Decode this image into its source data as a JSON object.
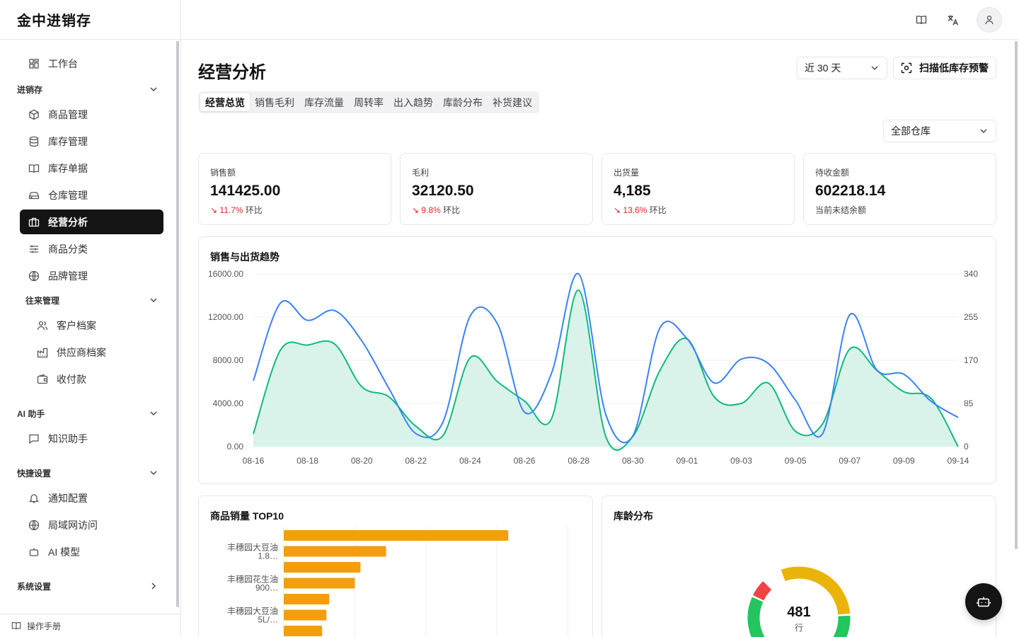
{
  "app": {
    "title": "金中进销存"
  },
  "sidebar": {
    "workspace": "工作台",
    "groups": {
      "inventory": "进销存",
      "partners": "往来管理",
      "ai": "AI 助手",
      "shortcuts": "快捷设置",
      "system": "系统设置"
    },
    "items": {
      "products": "商品管理",
      "stock": "库存管理",
      "documents": "库存单据",
      "warehouse": "仓库管理",
      "analytics": "经营分析",
      "categories": "商品分类",
      "brands": "品牌管理",
      "customers": "客户档案",
      "suppliers": "供应商档案",
      "payments": "收付款",
      "knowledge": "知识助手",
      "notifications": "通知配置",
      "lan": "局域网访问",
      "ai_model": "AI 模型"
    },
    "manual": "操作手册"
  },
  "page": {
    "title": "经营分析",
    "range": "近 30 天",
    "scan_button": "扫描低库存预警",
    "tabs": [
      "经营总览",
      "销售毛利",
      "库存流量",
      "周转率",
      "出入趋势",
      "库龄分布",
      "补货建议"
    ],
    "active_tab": 0,
    "warehouse": "全部仓库"
  },
  "kpis": [
    {
      "label": "销售额",
      "value": "141425.00",
      "change": "11.7%",
      "suffix": "环比"
    },
    {
      "label": "毛利",
      "value": "32120.50",
      "change": "9.8%",
      "suffix": "环比"
    },
    {
      "label": "出货量",
      "value": "4,185",
      "change": "13.6%",
      "suffix": "环比"
    },
    {
      "label": "待收金额",
      "value": "602218.14",
      "note": "当前未结余额"
    }
  ],
  "colors": {
    "sales": "#3b82f6",
    "ship": "#10b981",
    "ship_fill": "#d9f3ea",
    "bar": "#f59e0b",
    "down": "#dc2626",
    "donut": [
      "#eab308",
      "#22c55e",
      "#22c55e",
      "#ef4444"
    ]
  },
  "chart_data": [
    {
      "type": "line",
      "title": "销售与出货趋势",
      "x": [
        "08-16",
        "08-17",
        "08-18",
        "08-19",
        "08-20",
        "08-21",
        "08-22",
        "08-23",
        "08-24",
        "08-25",
        "08-26",
        "08-27",
        "08-28",
        "08-29",
        "08-30",
        "08-31",
        "09-01",
        "09-02",
        "09-03",
        "09-04",
        "09-05",
        "09-06",
        "09-07",
        "09-08",
        "09-09",
        "09-10",
        "09-14"
      ],
      "x_ticks": [
        "08-16",
        "08-18",
        "08-20",
        "08-22",
        "08-24",
        "08-26",
        "08-28",
        "08-30",
        "09-01",
        "09-03",
        "09-05",
        "09-07",
        "09-09",
        "09-14"
      ],
      "y_left_ticks": [
        "0.00",
        "4000.00",
        "8000.00",
        "12000.00",
        "16000.00"
      ],
      "y_right_ticks": [
        "0",
        "85",
        "170",
        "255",
        "340"
      ],
      "ylim_left": [
        0,
        16000
      ],
      "ylim_right": [
        0,
        340
      ],
      "series": [
        {
          "axis": "left",
          "values": [
            6100,
            13300,
            11700,
            12600,
            9800,
            5400,
            1200,
            2300,
            12100,
            11400,
            3200,
            6800,
            16000,
            3000,
            1000,
            11000,
            10000,
            5900,
            8100,
            7700,
            4300,
            1200,
            12200,
            7100,
            6700,
            4200,
            2700
          ]
        },
        {
          "axis": "right",
          "values": [
            25,
            190,
            200,
            202,
            118,
            98,
            40,
            22,
            175,
            128,
            90,
            55,
            308,
            20,
            20,
            150,
            212,
            98,
            85,
            125,
            30,
            45,
            192,
            150,
            108,
            95,
            0
          ]
        }
      ]
    },
    {
      "type": "bar",
      "title": "商品销量 TOP10",
      "categories": [
        "丰穗园大豆油 1.8…",
        "丰穗园花生油 900…",
        "丰穗园大豆油 5L/…"
      ],
      "values": [
        316,
        144,
        108,
        100,
        64,
        60,
        54
      ]
    },
    {
      "type": "pie",
      "title": "库龄分布",
      "total": "481",
      "unit": "行",
      "values": [
        0.3,
        0.2,
        0.38,
        0.06
      ]
    }
  ]
}
